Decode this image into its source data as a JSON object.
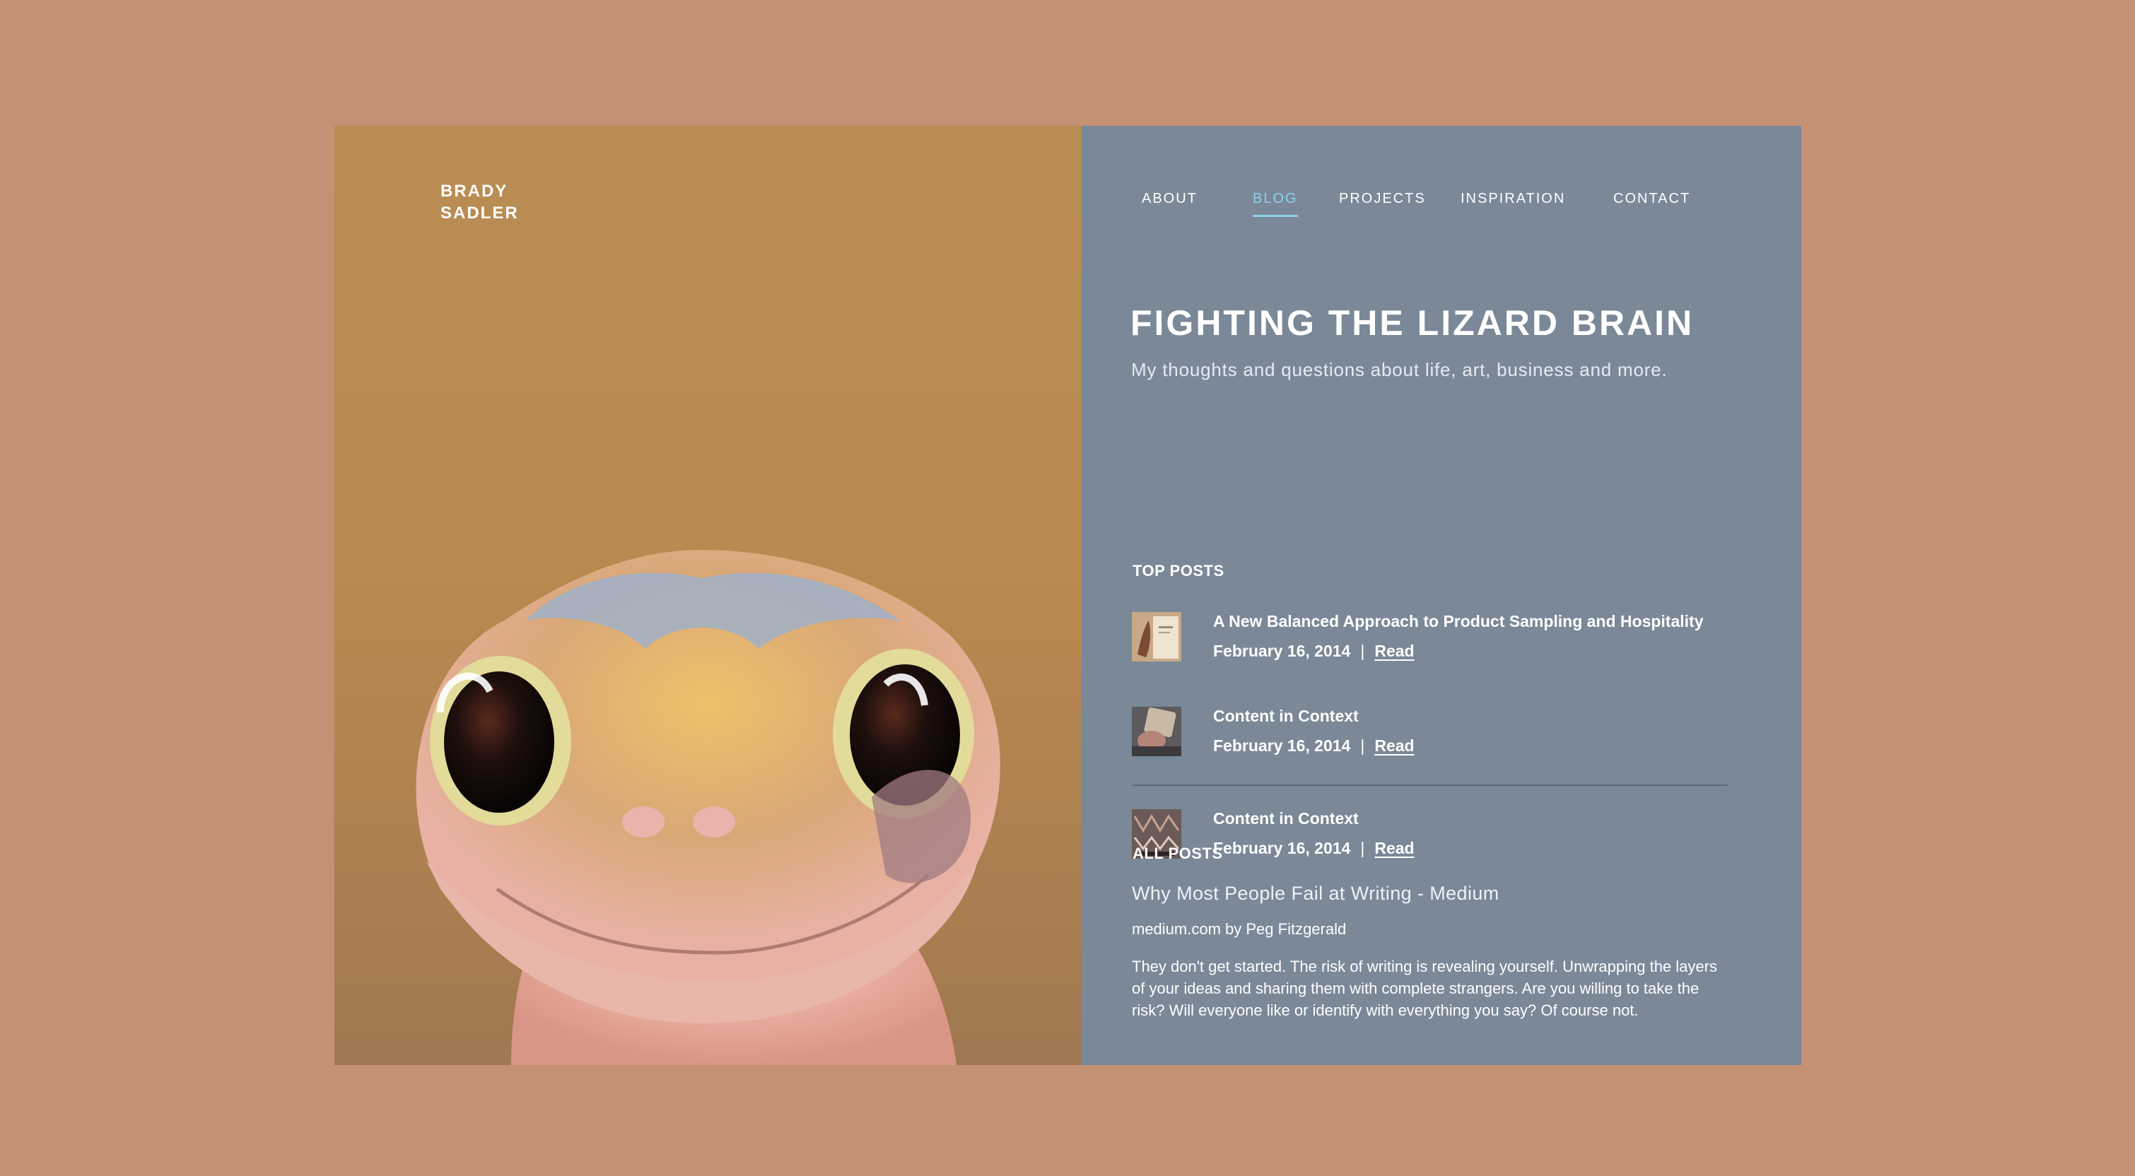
{
  "brand": {
    "line1": "BRADY",
    "line2": "SADLER"
  },
  "nav": {
    "items": [
      {
        "label": "ABOUT",
        "active": false
      },
      {
        "label": "BLOG",
        "active": true
      },
      {
        "label": "PROJECTS",
        "active": false
      },
      {
        "label": "INSPIRATION",
        "active": false
      },
      {
        "label": "CONTACT",
        "active": false
      }
    ]
  },
  "header": {
    "title": "FIGHTING THE LIZARD BRAIN",
    "subtitle": "My thoughts and questions about life, art, business and more."
  },
  "top_posts": {
    "label": "TOP POSTS",
    "items": [
      {
        "title": "A New Balanced Approach to Product Sampling and Hospitality",
        "date": "February 16, 2014",
        "separator": "|",
        "link": "Read"
      },
      {
        "title": "Content in Context",
        "date": "February 16, 2014",
        "separator": "|",
        "link": "Read"
      },
      {
        "title": "Content in Context",
        "date": "February 16, 2014",
        "separator": "|",
        "link": "Read"
      }
    ]
  },
  "all_posts": {
    "label": "ALL POSTS",
    "article": {
      "title": "Why Most People Fail at Writing - Medium",
      "source": "medium.com by Peg Fitzgerald",
      "excerpt": "They don't get started. The risk of writing is revealing yourself. Unwrapping the layers of your ideas and sharing them with complete strangers. Are you willing to take the risk? Will everyone like or identify with everything you say? Of course not."
    }
  },
  "colors": {
    "page_background": "#c49174",
    "hero_background": "#b98d54",
    "content_background": "#7a8898",
    "nav_active": "#8fd1ee",
    "divider": "#5d6a79"
  }
}
